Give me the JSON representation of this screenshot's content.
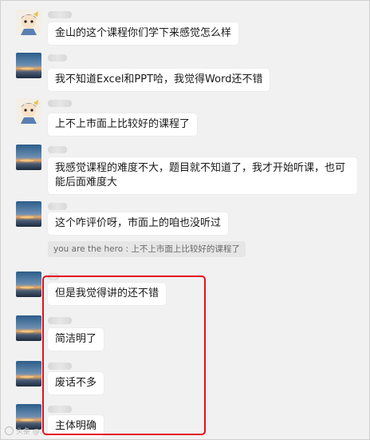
{
  "messages": [
    {
      "avatar": "cartoon-avatar",
      "text": "金山的这个课程你们学下来感觉怎么样"
    },
    {
      "avatar": "sunset-avatar",
      "text": "我不知道Excel和PPT哈，我觉得Word还不错"
    },
    {
      "avatar": "cartoon-avatar",
      "text": "上不上市面上比较好的课程了"
    },
    {
      "avatar": "sunset-avatar",
      "text": "我感觉课程的难度不大，题目就不知道了，我才开始听课，也可能后面难度大"
    },
    {
      "avatar": "sunset-avatar",
      "text": "这个咋评价呀，市面上的咱也没听过",
      "quote": "you are the hero : 上不上市面上比较好的课程了"
    },
    {
      "avatar": "sunset-avatar",
      "text": "但是我觉得讲的还不错"
    },
    {
      "avatar": "sunset-avatar",
      "text": "简洁明了"
    },
    {
      "avatar": "sunset-avatar",
      "text": "废话不多"
    },
    {
      "avatar": "sunset-avatar",
      "text": "主体明确"
    }
  ],
  "watermark": "头条 @...",
  "colors": {
    "background": "#f1f1f1",
    "bubble": "#ffffff",
    "highlight": "#e5101d",
    "quote_bg": "#e6e6e6"
  }
}
